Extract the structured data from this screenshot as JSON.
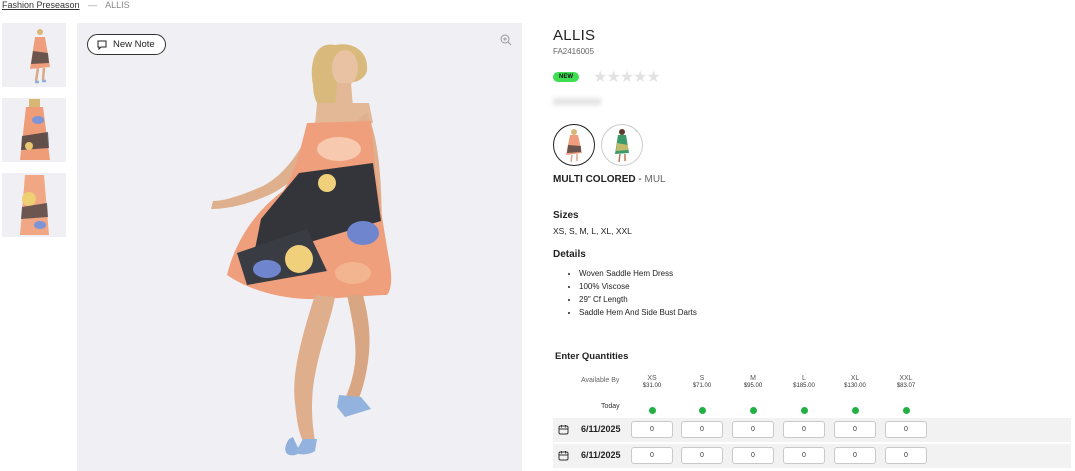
{
  "breadcrumb": {
    "parent": "Fashion Preseason",
    "separator": "—",
    "current": "ALLIS"
  },
  "note_button": {
    "label": "New Note",
    "icon": "note-icon"
  },
  "zoom_icon": "zoom-in-icon",
  "product": {
    "title": "ALLIS",
    "sku": "FA2416005",
    "badge": "NEW",
    "rating_stars": 0,
    "rating_max": 5,
    "blurred_text": "XXXXXXXX",
    "color_name": "MULTI COLORED",
    "color_sep": " - ",
    "color_code": "MUL",
    "sizes_heading": "Sizes",
    "sizes": "XS, S, M, L, XL, XXL",
    "details_heading": "Details",
    "details": [
      "Woven Saddle Hem Dress",
      "100% Viscose",
      "29\" Cf Length",
      "Saddle Hem And Side Bust Darts"
    ]
  },
  "quantities": {
    "heading": "Enter Quantities",
    "available_label": "Available By",
    "today_label": "Today",
    "sizes": [
      {
        "size": "XS",
        "price": "$31.00"
      },
      {
        "size": "S",
        "price": "$71.00"
      },
      {
        "size": "M",
        "price": "$95.00"
      },
      {
        "size": "L",
        "price": "$185.00"
      },
      {
        "size": "XL",
        "price": "$130.00"
      },
      {
        "size": "XXL",
        "price": "$83.07"
      }
    ],
    "rows": [
      {
        "date": "6/11/2025",
        "values": [
          "0",
          "0",
          "0",
          "0",
          "0",
          "0"
        ]
      },
      {
        "date": "6/11/2025",
        "values": [
          "0",
          "0",
          "0",
          "0",
          "0",
          "0"
        ]
      }
    ]
  },
  "colors": {
    "new_badge": "#3fdd52",
    "available_dot": "#22b042",
    "stage_bg": "#f0eff3"
  }
}
